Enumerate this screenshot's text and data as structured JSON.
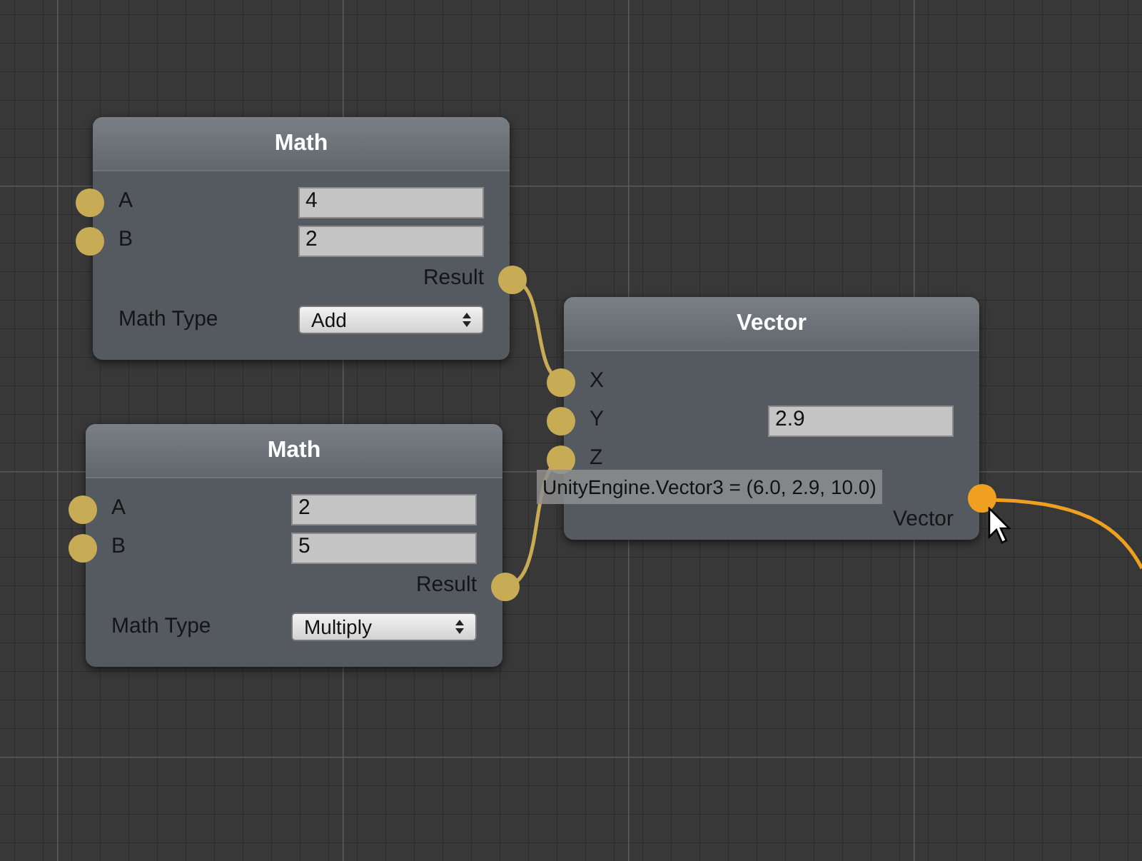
{
  "nodes": [
    {
      "kind": "math",
      "title": "Math",
      "inputs": [
        {
          "label": "A",
          "value": "4"
        },
        {
          "label": "B",
          "value": "2"
        }
      ],
      "output": {
        "label": "Result",
        "hovered": false
      },
      "dropdown": {
        "label": "Math Type",
        "value": "Add"
      }
    },
    {
      "kind": "vector",
      "title": "Vector",
      "inputs": [
        {
          "label": "X"
        },
        {
          "label": "Y",
          "value": "2.9"
        },
        {
          "label": "Z"
        }
      ],
      "output": {
        "label": "Vector",
        "hovered": true
      }
    },
    {
      "kind": "math",
      "title": "Math",
      "inputs": [
        {
          "label": "A",
          "value": "2"
        },
        {
          "label": "B",
          "value": "5"
        }
      ],
      "output": {
        "label": "Result",
        "hovered": false
      },
      "dropdown": {
        "label": "Math Type",
        "value": "Multiply"
      }
    }
  ],
  "tooltip": {
    "text": "UnityEngine.Vector3 = (6.0, 2.9, 10.0)"
  }
}
